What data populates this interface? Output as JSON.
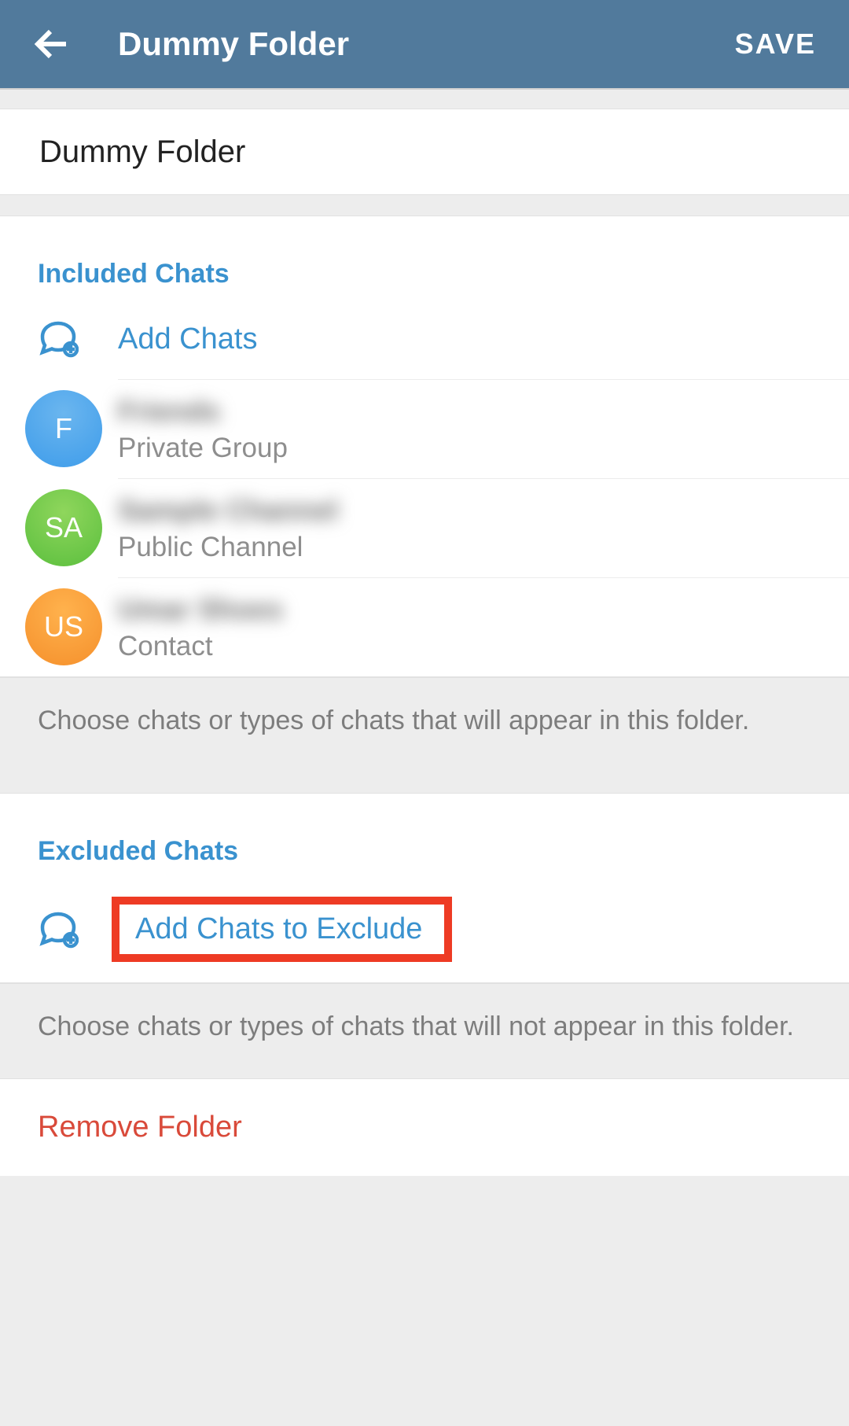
{
  "header": {
    "title": "Dummy Folder",
    "save_label": "SAVE"
  },
  "folder_name": "Dummy Folder",
  "included": {
    "header": "Included Chats",
    "add_label": "Add Chats",
    "hint": "Choose chats or types of chats that will appear in this folder.",
    "chats": [
      {
        "initials": "F",
        "name": "Friends",
        "type": "Private Group",
        "avatar_color": "grad-blue"
      },
      {
        "initials": "SA",
        "name": "Sample Channel",
        "type": "Public Channel",
        "avatar_color": "grad-green"
      },
      {
        "initials": "US",
        "name": "Umar Shoes",
        "type": "Contact",
        "avatar_color": "grad-orange"
      }
    ]
  },
  "excluded": {
    "header": "Excluded Chats",
    "add_label": "Add Chats to Exclude",
    "hint": "Choose chats or types of chats that will not appear in this folder."
  },
  "remove_label": "Remove Folder"
}
